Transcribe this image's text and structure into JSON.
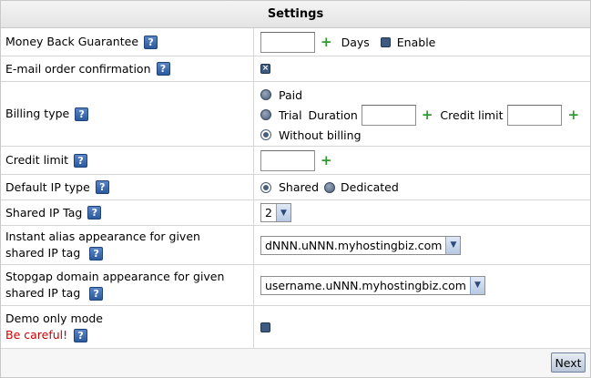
{
  "header": {
    "title": "Settings"
  },
  "rows": {
    "money_back": {
      "label": "Money Back Guarantee",
      "unit": "Days",
      "enable_label": "Enable"
    },
    "email_confirm": {
      "label": "E-mail order confirmation"
    },
    "billing": {
      "label": "Billing type",
      "paid": "Paid",
      "trial": "Trial",
      "duration": "Duration",
      "credit_limit": "Credit limit",
      "without": "Without billing"
    },
    "credit_limit": {
      "label": "Credit limit"
    },
    "ip_type": {
      "label": "Default IP type",
      "shared": "Shared",
      "dedicated": "Dedicated"
    },
    "shared_tag": {
      "label": "Shared IP Tag",
      "value": "2"
    },
    "instant_alias": {
      "label_line1": "Instant alias appearance for given",
      "label_line2": "shared IP tag",
      "value": "dNNN.uNNN.myhostingbiz.com"
    },
    "stopgap": {
      "label_line1": "Stopgap domain appearance for given",
      "label_line2": "shared IP tag",
      "value": "username.uNNN.myhostingbiz.com"
    },
    "demo": {
      "label": "Demo only mode",
      "warning": "Be careful!"
    }
  },
  "footer": {
    "next_label": "Next"
  },
  "colors": {
    "accent": "#3e5a80",
    "plus": "#2f9a2f",
    "warning": "#cc0000"
  }
}
